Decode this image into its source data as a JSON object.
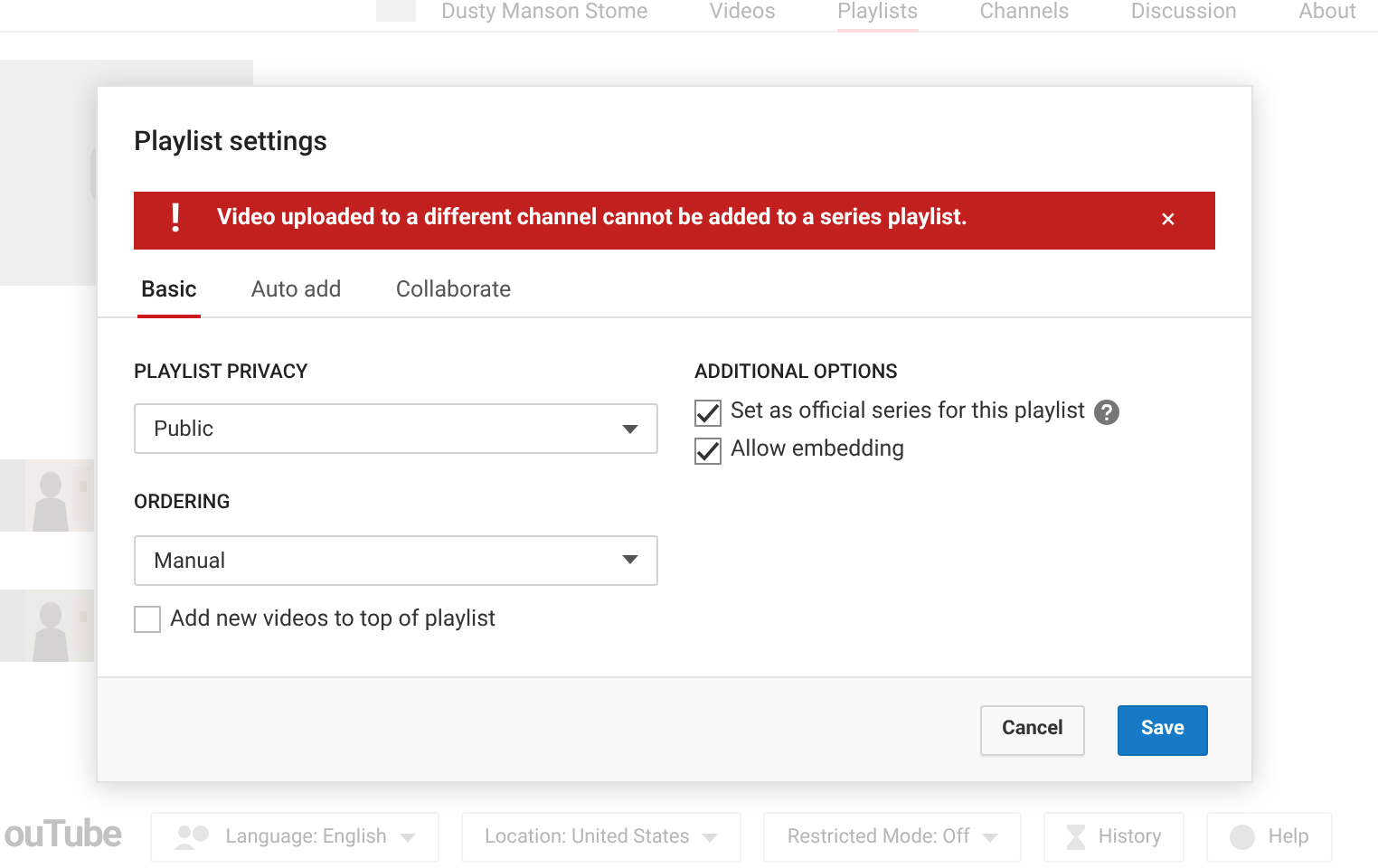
{
  "channel_nav": {
    "channel_name": "Dusty Manson Stome",
    "tabs": [
      {
        "label": "Videos",
        "selected": false
      },
      {
        "label": "Playlists",
        "selected": true
      },
      {
        "label": "Channels",
        "selected": false
      },
      {
        "label": "Discussion",
        "selected": false
      },
      {
        "label": "About",
        "selected": false
      }
    ]
  },
  "dialog": {
    "title": "Playlist settings",
    "error": {
      "icon": "!",
      "message": "Video uploaded to a different channel cannot be added to a series playlist.",
      "close": "×"
    },
    "tabs": [
      {
        "label": "Basic",
        "selected": true
      },
      {
        "label": "Auto add",
        "selected": false
      },
      {
        "label": "Collaborate",
        "selected": false
      }
    ],
    "privacy": {
      "label": "PLAYLIST PRIVACY",
      "value": "Public"
    },
    "ordering": {
      "label": "ORDERING",
      "value": "Manual"
    },
    "add_to_top": {
      "label": "Add new videos to top of playlist",
      "checked": false
    },
    "additional_options": {
      "label": "ADDITIONAL OPTIONS",
      "options": [
        {
          "label": "Set as official series for this playlist",
          "checked": true,
          "help": true
        },
        {
          "label": "Allow embedding",
          "checked": true,
          "help": false
        }
      ]
    },
    "buttons": [
      {
        "label": "Cancel",
        "kind": "secondary"
      },
      {
        "label": "Save",
        "kind": "primary"
      }
    ]
  },
  "footer": {
    "logo": "ouTube",
    "items": [
      {
        "label": "Language: English",
        "kind": "language"
      },
      {
        "label": "Location: United States",
        "kind": "dropdown"
      },
      {
        "label": "Restricted Mode: Off",
        "kind": "dropdown"
      },
      {
        "label": "History",
        "kind": "history"
      },
      {
        "label": "Help",
        "kind": "help"
      }
    ]
  }
}
